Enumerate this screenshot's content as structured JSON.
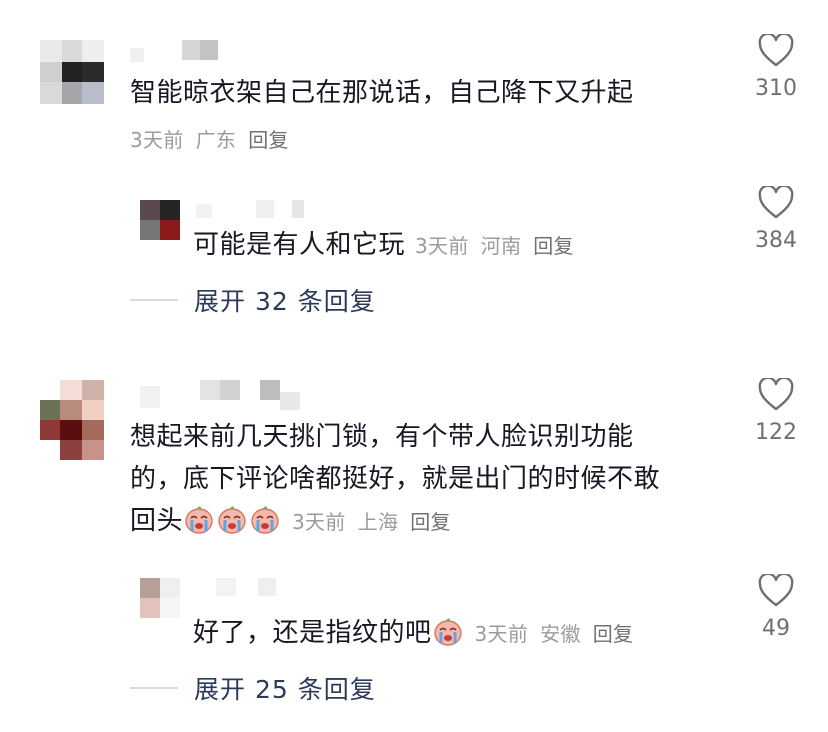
{
  "comments": [
    {
      "text": "智能晾衣架自己在那说话，自己降下又升起",
      "time": "3天前",
      "location": "广东",
      "reply_label": "回复",
      "likes": "310",
      "replies": [
        {
          "text": "可能是有人和它玩",
          "time": "3天前",
          "location": "河南",
          "reply_label": "回复",
          "likes": "384"
        }
      ],
      "expand_label": "展开 32 条回复"
    },
    {
      "text_lines": [
        "想起来前几天挑门锁，有个带人脸识别功能",
        "的，底下评论啥都挺好，就是出门的时候不敢",
        "回头"
      ],
      "emojis": [
        "crying-emoji",
        "crying-emoji",
        "crying-emoji"
      ],
      "time": "3天前",
      "location": "上海",
      "reply_label": "回复",
      "likes": "122",
      "replies": [
        {
          "text": "好了，还是指纹的吧",
          "emojis": [
            "crying-emoji"
          ],
          "time": "3天前",
          "location": "安徽",
          "reply_label": "回复",
          "likes": "49"
        }
      ],
      "expand_label": "展开 25 条回复"
    }
  ],
  "colors": {
    "text": "#161823",
    "meta": "#9a9ba0",
    "expand": "#2c3a5a",
    "icon": "#6f7075"
  }
}
